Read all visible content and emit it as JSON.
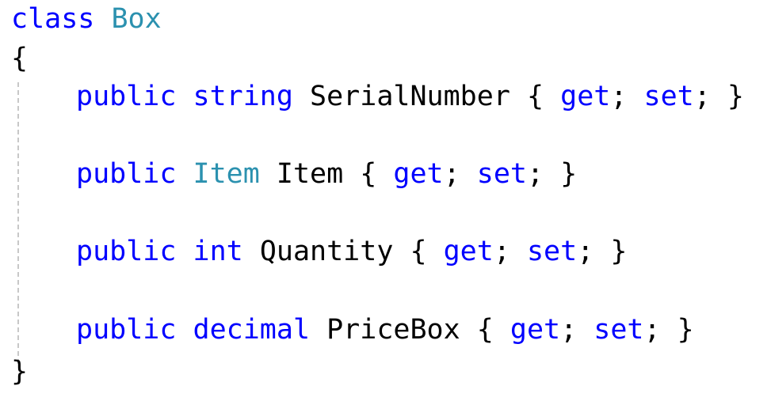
{
  "code": {
    "line1": {
      "keyword": "class",
      "name": "Box"
    },
    "open_brace": "{",
    "close_brace": "}",
    "properties": [
      {
        "modifier": "public",
        "type": "string",
        "name": "SerialNumber",
        "get": "get",
        "set": "set"
      },
      {
        "modifier": "public",
        "type": "Item",
        "name": "Item",
        "get": "get",
        "set": "set"
      },
      {
        "modifier": "public",
        "type": "int",
        "name": "Quantity",
        "get": "get",
        "set": "set"
      },
      {
        "modifier": "public",
        "type": "decimal",
        "name": "PriceBox",
        "get": "get",
        "set": "set"
      }
    ]
  },
  "colors": {
    "keyword": "#0000ff",
    "user_type": "#2b91af",
    "text": "#000000",
    "indent_guide": "#c8c8c8"
  }
}
